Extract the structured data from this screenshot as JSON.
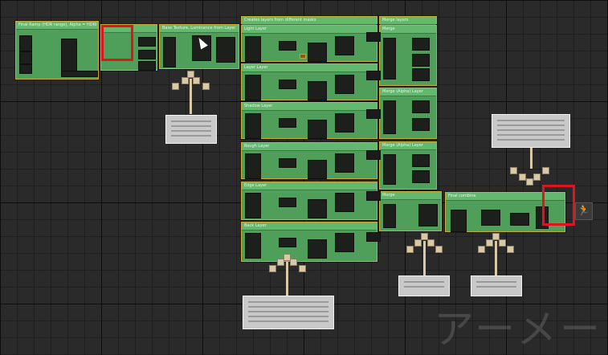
{
  "nodes": {
    "n1": {
      "title": "Final Ramp (HDR range), Alpha = HDRI"
    },
    "n2": {
      "title": ""
    },
    "n3": {
      "title": "Base Texture, Luminance from Layer"
    },
    "header_a": {
      "title": "Creates layers from different masks"
    },
    "header_b": {
      "title": "Merge layers"
    },
    "layer1": {
      "title": "Light Layer"
    },
    "layer2": {
      "title": "Layer Layer"
    },
    "layer3": {
      "title": "Shadow Layer"
    },
    "layer4": {
      "title": "Rough Layer"
    },
    "layer5": {
      "title": "Edge Layer"
    },
    "layer6": {
      "title": "Back Layer"
    },
    "merge1": {
      "title": "Merge"
    },
    "merge2": {
      "title": "Merge (Alpha) Layer"
    },
    "merge3": {
      "title": "Merge (Alpha) Layer"
    },
    "merge4": {
      "title": "Merge"
    },
    "final": {
      "title": "Final combine"
    }
  },
  "watermark": "アーメー",
  "runner_icon": "running-figure-icon"
}
